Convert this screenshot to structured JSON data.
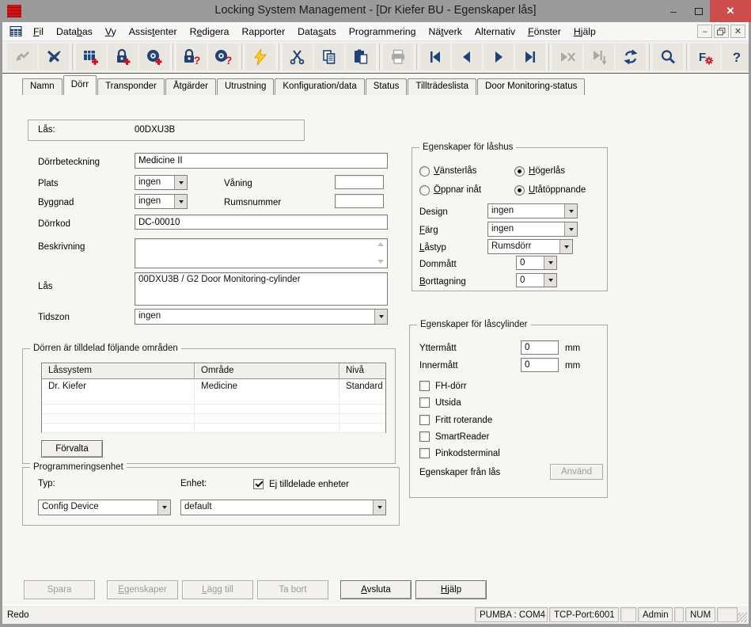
{
  "titlebar": {
    "title": "Locking System Management - [Dr Kiefer BU - Egenskaper lås]",
    "minimize": "–",
    "close": "✕"
  },
  "menu": {
    "items": [
      "Fil",
      "Databas",
      "Vy",
      "Assistenter",
      "Redigera",
      "Rapporter",
      "Datasats",
      "Programmering",
      "Nätverk",
      "Alternativ",
      "Fönster",
      "Hjälp"
    ]
  },
  "mdi": {
    "minimize": "–",
    "close": "✕"
  },
  "toolbar": {
    "buttons": [
      {
        "name": "jump-arrow",
        "enabled": false
      },
      {
        "name": "disconnect",
        "enabled": true
      },
      {
        "name": "new-locking-system",
        "enabled": true
      },
      {
        "name": "new-lock",
        "enabled": true
      },
      {
        "name": "new-transponder",
        "enabled": true
      },
      {
        "name": "read-lock",
        "enabled": true
      },
      {
        "name": "read-transponder",
        "enabled": true
      },
      {
        "name": "program",
        "enabled": true
      },
      {
        "name": "cut",
        "enabled": true
      },
      {
        "name": "copy",
        "enabled": true
      },
      {
        "name": "paste",
        "enabled": true
      },
      {
        "name": "print",
        "enabled": false
      },
      {
        "name": "first-record",
        "enabled": true
      },
      {
        "name": "previous-record",
        "enabled": true
      },
      {
        "name": "next-record",
        "enabled": true
      },
      {
        "name": "last-record",
        "enabled": true
      },
      {
        "name": "cancel-navigation",
        "enabled": false
      },
      {
        "name": "goto-record",
        "enabled": false
      },
      {
        "name": "refresh",
        "enabled": true
      },
      {
        "name": "search",
        "enabled": true
      },
      {
        "name": "filter-settings",
        "enabled": true
      },
      {
        "name": "help",
        "enabled": true
      }
    ]
  },
  "tabs": {
    "items": [
      "Namn",
      "Dörr",
      "Transponder",
      "Åtgärder",
      "Utrustning",
      "Konfiguration/data",
      "Status",
      "Tillträdeslista",
      "Door Monitoring-status"
    ],
    "active": "Dörr"
  },
  "form": {
    "lock_ref": {
      "label": "Lås:",
      "value": "00DXU3B"
    },
    "door_name": {
      "label": "Dörrbeteckning",
      "value": "Medicine II"
    },
    "location": {
      "label": "Plats",
      "value": "ingen"
    },
    "floor": {
      "label": "Våning",
      "value": ""
    },
    "building": {
      "label": "Byggnad",
      "value": "ingen"
    },
    "room": {
      "label": "Rumsnummer",
      "value": ""
    },
    "door_code": {
      "label": "Dörrkod",
      "value": "DC-00010"
    },
    "description": {
      "label": "Beskrivning",
      "value": ""
    },
    "lock": {
      "label": "Lås",
      "value": "00DXU3B / G2 Door Monitoring-cylinder"
    },
    "timezone": {
      "label": "Tidszon",
      "value": "ingen"
    }
  },
  "areas": {
    "title": "Dörren är tilldelad följande områden",
    "columns": [
      "Låssystem",
      "Område",
      "Nivå"
    ],
    "rows": [
      [
        "Dr. Kiefer",
        "Medicine",
        "Standard"
      ]
    ],
    "manage": "Förvalta"
  },
  "programming": {
    "title": "Programmeringsenhet",
    "type_label": "Typ:",
    "device_label": "Enhet:",
    "unassigned_label": "Ej tilldelade enheter",
    "unassigned_checked": true,
    "type_value": "Config Device",
    "device_value": "default"
  },
  "housing": {
    "title": "Egenskaper för låshus",
    "left_lock": {
      "label": "Vänsterlås",
      "selected": false
    },
    "right_lock": {
      "label": "Högerlås",
      "selected": true
    },
    "inward": {
      "label": "Öppnar inåt",
      "selected": false
    },
    "outward": {
      "label": "Utåtöppnande",
      "selected": true
    },
    "design": {
      "label": "Design",
      "value": "ingen"
    },
    "color": {
      "label": "Färg",
      "value": "ingen"
    },
    "lock_type": {
      "label": "Låstyp",
      "value": "Rumsdörr"
    },
    "dom": {
      "label": "Dommått",
      "value": "0"
    },
    "removal": {
      "label": "Borttagning",
      "value": "0"
    }
  },
  "cylinder": {
    "title": "Egenskaper för låscylinder",
    "outer": {
      "label": "Yttermått",
      "value": "0",
      "unit": "mm"
    },
    "inner": {
      "label": "Innermått",
      "value": "0",
      "unit": "mm"
    },
    "options": [
      "FH-dörr",
      "Utsida",
      "Fritt roterande",
      "SmartReader",
      "Pinkodsterminal"
    ],
    "from_lock": "Egenskaper från lås",
    "apply": "Använd"
  },
  "footer": {
    "save": "Spara",
    "properties": "Egenskaper",
    "add": "Lägg till",
    "remove": "Ta bort",
    "exit": "Avsluta",
    "help": "Hjälp"
  },
  "statusbar": {
    "ready": "Redo",
    "com": "PUMBA : COM4",
    "tcp": "TCP-Port:6001",
    "user": "Admin",
    "num": "NUM"
  },
  "colors": {
    "titlebar": "#9b9b9b",
    "close_button": "#cb4e4c",
    "accent_red": "#cc1320",
    "icon_navy": "#1e4276",
    "lightning_yellow": "#ffd21e"
  }
}
